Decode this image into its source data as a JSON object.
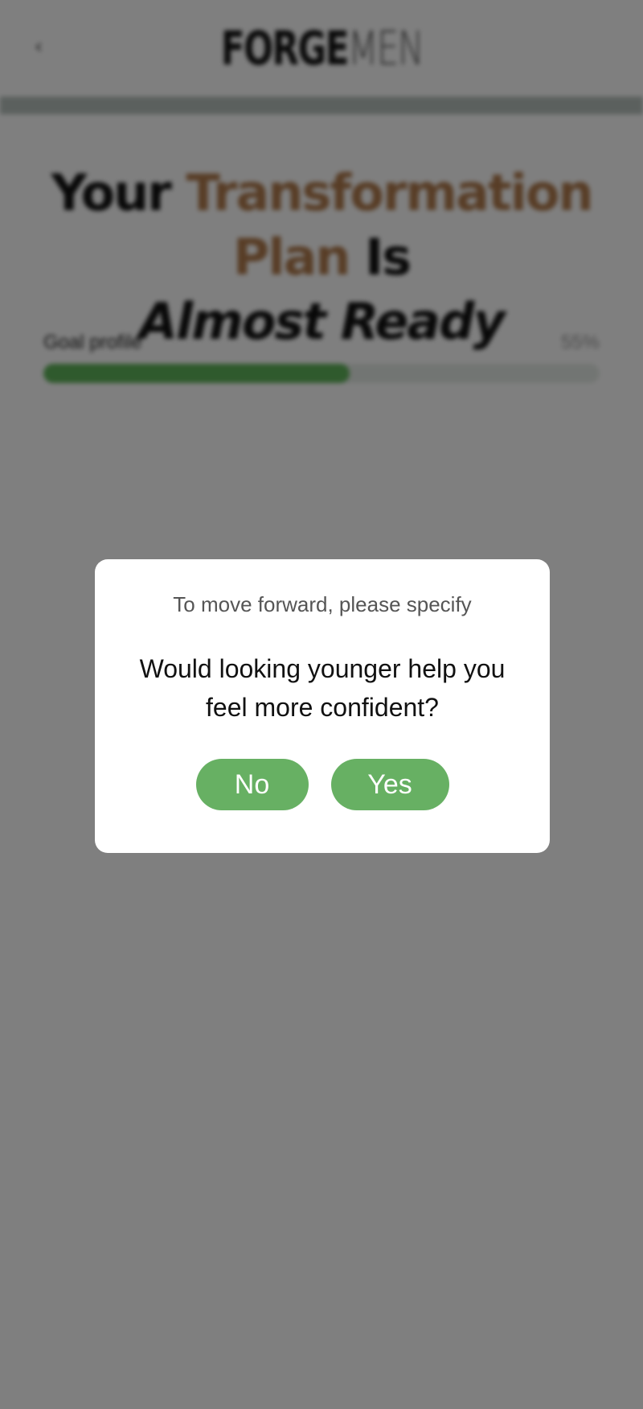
{
  "header": {
    "back_icon": "chevron-left-icon",
    "back_glyph": "‹",
    "logo_bold": "FORGE",
    "logo_thin": "MEN"
  },
  "headline": {
    "part1": "Your ",
    "accent": "Transformation Plan",
    "part2": " Is",
    "line2": "Almost Ready"
  },
  "progress": {
    "label": "Goal profile",
    "percent_text": "55%",
    "value": 0.55,
    "fill_color": "#5fb45a"
  },
  "modal": {
    "subtitle": "To move forward, please specify",
    "question": "Would looking younger help you feel more confident?",
    "no_label": "No",
    "yes_label": "Yes",
    "button_color": "#67b063"
  }
}
